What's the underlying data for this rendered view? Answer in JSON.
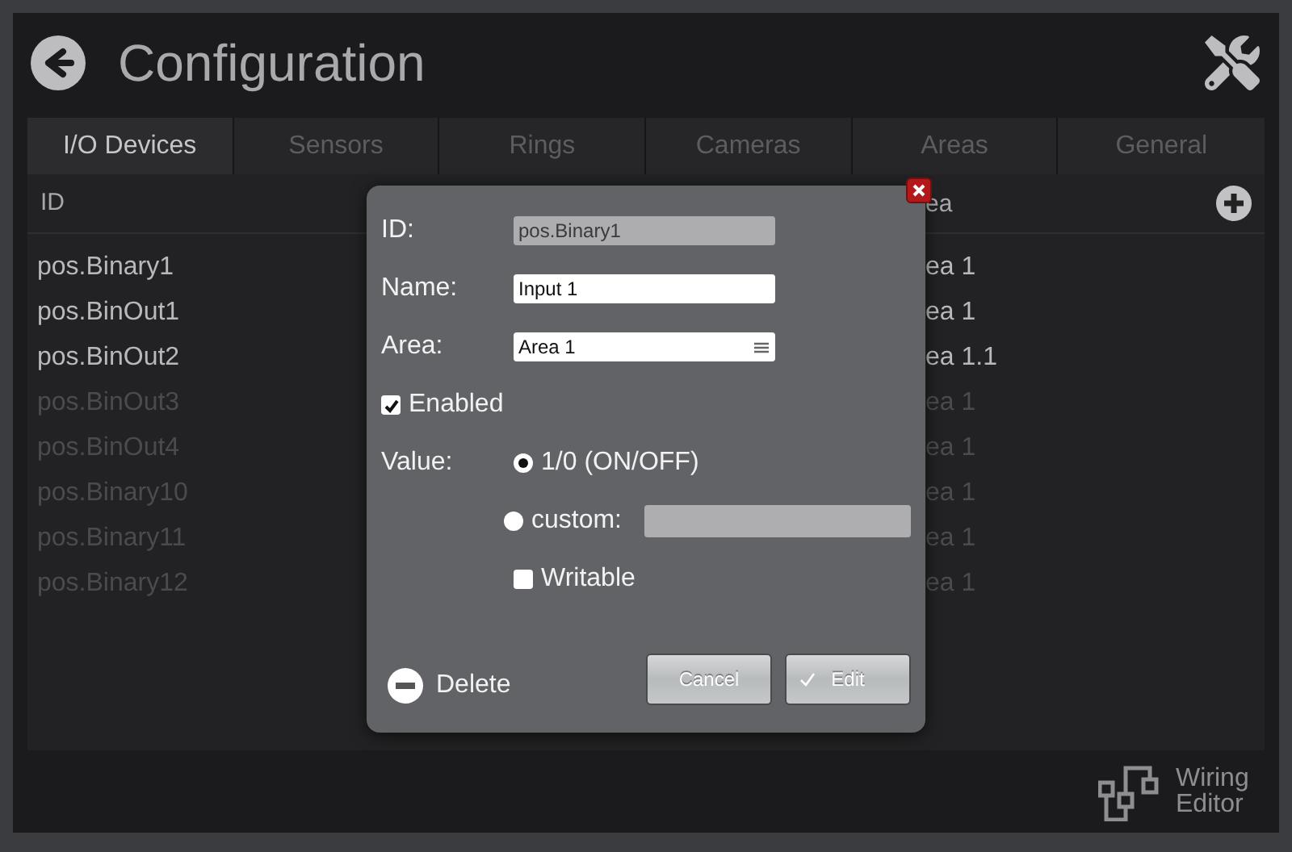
{
  "header": {
    "title": "Configuration"
  },
  "tabs": [
    {
      "label": "I/O Devices",
      "selected": true
    },
    {
      "label": "Sensors",
      "selected": false
    },
    {
      "label": "Rings",
      "selected": false
    },
    {
      "label": "Cameras",
      "selected": false
    },
    {
      "label": "Areas",
      "selected": false
    },
    {
      "label": "General",
      "selected": false
    }
  ],
  "table": {
    "columns": [
      "ID",
      "ea"
    ],
    "rows": [
      {
        "id": "pos.Binary1",
        "area": "ea 1",
        "disabled": false
      },
      {
        "id": "pos.BinOut1",
        "area": "ea 1",
        "disabled": false
      },
      {
        "id": "pos.BinOut2",
        "area": "ea 1.1",
        "disabled": false
      },
      {
        "id": "pos.BinOut3",
        "area": "ea 1",
        "disabled": true
      },
      {
        "id": "pos.BinOut4",
        "area": "ea 1",
        "disabled": true
      },
      {
        "id": "pos.Binary10",
        "area": "ea 1",
        "disabled": true
      },
      {
        "id": "pos.Binary11",
        "area": "ea 1",
        "disabled": true
      },
      {
        "id": "pos.Binary12",
        "area": "ea 1",
        "disabled": true
      }
    ]
  },
  "dialog": {
    "fields": [
      {
        "label": "ID:",
        "value": "pos.Binary1",
        "kind": "readonly"
      },
      {
        "label": "Name:",
        "value": "Input 1",
        "kind": "text"
      },
      {
        "label": "Area:",
        "value": "Area 1",
        "kind": "select"
      }
    ],
    "enabled": {
      "label": "Enabled",
      "checked": true
    },
    "value": {
      "label": "Value:",
      "options": [
        {
          "label": "1/0 (ON/OFF)",
          "selected": true,
          "kind": "plain"
        },
        {
          "label": "custom:",
          "selected": false,
          "kind": "custom"
        }
      ]
    },
    "writable": {
      "label": "Writable",
      "checked": false
    },
    "delete": "Delete",
    "buttons": [
      {
        "label": "Cancel",
        "kind": "cancel"
      },
      {
        "label": "Edit",
        "kind": "confirm"
      }
    ]
  },
  "footer": {
    "link": "Wiring Editor"
  }
}
